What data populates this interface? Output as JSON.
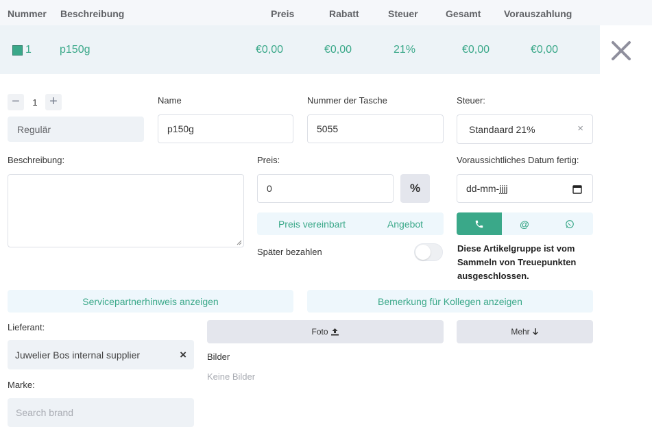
{
  "header": {
    "columns": [
      "Nummer",
      "Beschreibung",
      "Preis",
      "Rabatt",
      "Steuer",
      "Gesamt",
      "Vorauszahlung"
    ]
  },
  "item_row": {
    "nummer": "1",
    "beschreibung": "p150g",
    "preis": "€0,00",
    "rabatt": "€0,00",
    "steuer": "21%",
    "gesamt": "€0,00",
    "vorauszahlung": "€0,00",
    "close_icon": "close-icon"
  },
  "form": {
    "quantity": "1",
    "type_value": "Regulär",
    "name_label": "Name",
    "name_value": "p150g",
    "bag_label": "Nummer der Tasche",
    "bag_value": "5055",
    "tax_label": "Steuer:",
    "tax_value": "Standaard 21%",
    "description_label": "Beschreibung:",
    "price_label": "Preis:",
    "price_value": "0",
    "percent_symbol": "%",
    "expected_date_label": "Voraussichtliches Datum fertig:",
    "expected_date_placeholder": "dd-mm-jjjj",
    "price_agreed_label": "Preis vereinbart",
    "offer_label": "Angebot",
    "pay_later_label": "Später bezahlen",
    "pay_later_on": false,
    "loyalty_note": "Diese Artikelgruppe ist vom Sammeln von Treuepunkten ausgeschlossen.",
    "service_partner_button": "Servicepartnerhinweis anzeigen",
    "colleague_note_button": "Bemerkung für Kollegen anzeigen",
    "supplier_label": "Lieferant:",
    "supplier_value": "Juwelier Bos internal supplier",
    "photo_button": "Foto",
    "more_button": "Mehr",
    "images_label": "Bilder",
    "no_images": "Keine Bilder",
    "brand_label": "Marke:",
    "brand_placeholder": "Search brand"
  },
  "colors": {
    "accent": "#3aa889",
    "row_bg": "#edf3f7",
    "light_btn_bg": "#eef7fc",
    "gray_btn_bg": "#e4e6ed"
  }
}
